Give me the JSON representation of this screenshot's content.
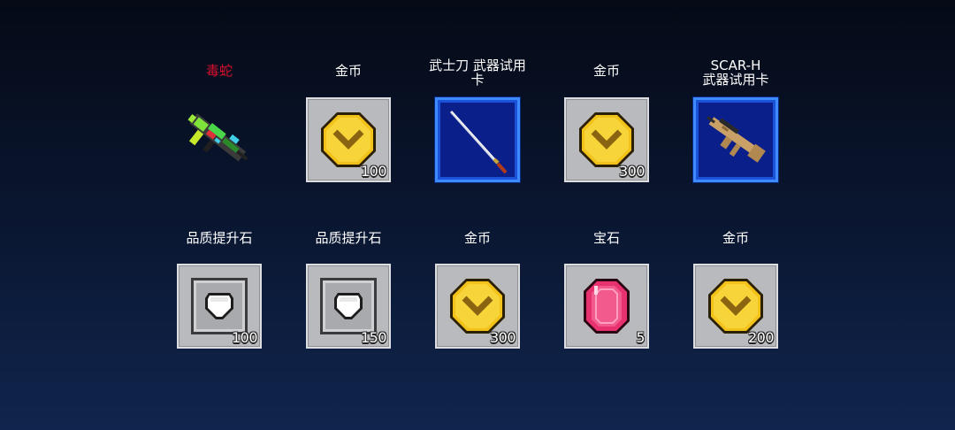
{
  "rewards": {
    "row1": [
      {
        "label": "毒蛇",
        "highlight_color": "#d8102e",
        "icon": "rifle-weapon-icon",
        "count": ""
      },
      {
        "label": "金币",
        "icon": "gold-coin-icon",
        "count": "100"
      },
      {
        "label": "武士刀 武器试用\n卡",
        "icon": "katana-sword-icon",
        "count": ""
      },
      {
        "label": "金币",
        "icon": "gold-coin-icon",
        "count": "300"
      },
      {
        "label": "SCAR-H\n武器试用卡",
        "icon": "scar-h-rifle-icon",
        "count": ""
      }
    ],
    "row2": [
      {
        "label": "品质提升石",
        "icon": "quality-stone-icon",
        "count": "100"
      },
      {
        "label": "品质提升石",
        "icon": "quality-stone-icon",
        "count": "150"
      },
      {
        "label": "金币",
        "icon": "gold-coin-icon",
        "count": "300"
      },
      {
        "label": "宝石",
        "icon": "pink-gem-icon",
        "count": "5"
      },
      {
        "label": "金币",
        "icon": "gold-coin-icon",
        "count": "200"
      }
    ]
  },
  "colors": {
    "tile_grey": "#b9babe",
    "tile_blue": "#0b1f8a",
    "coin_gold": "#f2c21b",
    "gem_pink": "#e8316f",
    "label_red": "#d8102e"
  }
}
